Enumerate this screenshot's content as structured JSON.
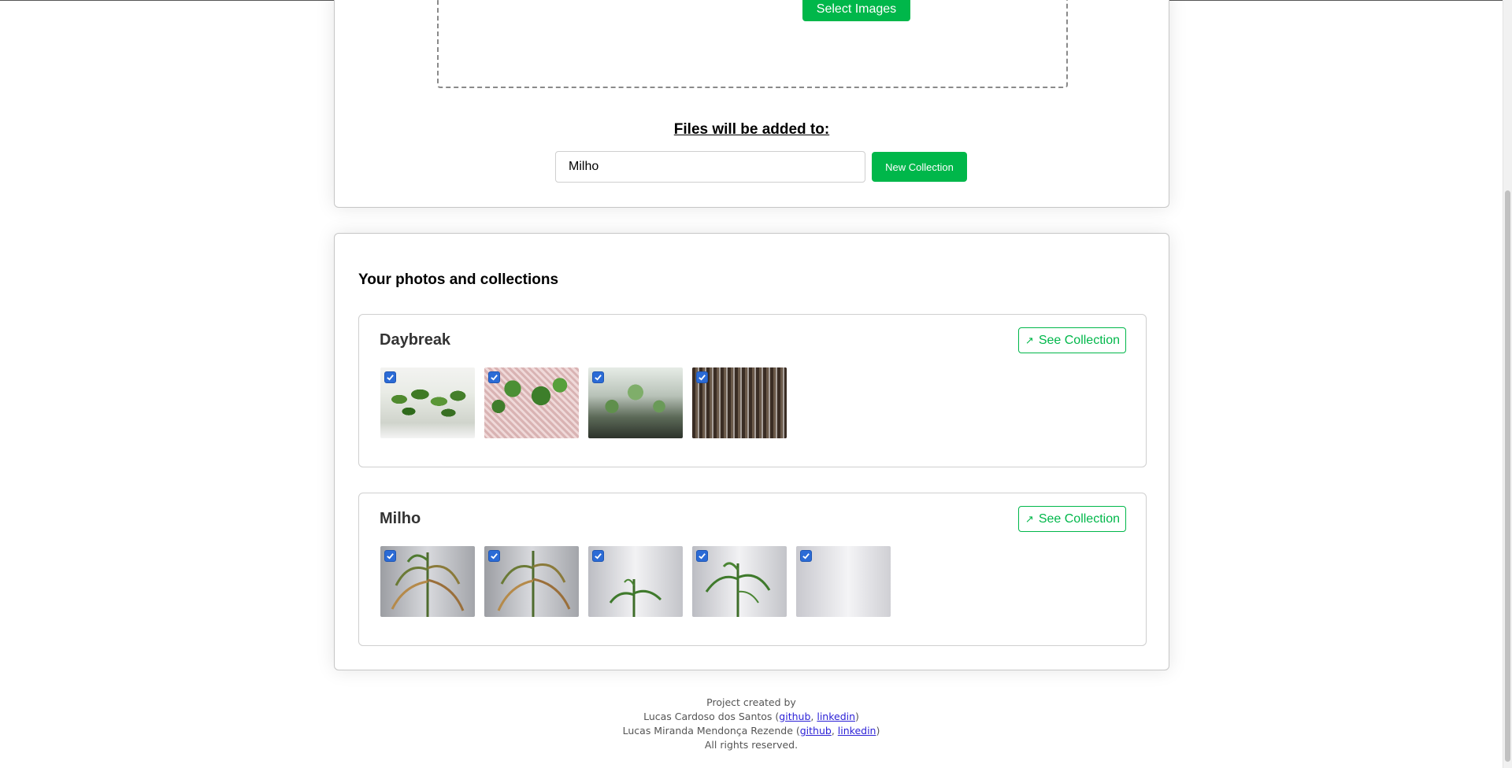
{
  "upload": {
    "select_images_label": "Select Images",
    "files_added_to_label": "Files will be added to:",
    "selected_collection": "Milho",
    "new_collection_label": "New Collection"
  },
  "photos": {
    "title": "Your photos and collections",
    "see_collection_label": "See Collection",
    "collections": [
      {
        "name": "Daybreak",
        "photo_count": 4,
        "all_checked": true
      },
      {
        "name": "Milho",
        "photo_count": 5,
        "all_checked": true
      }
    ]
  },
  "footer": {
    "line1": "Project created by",
    "author1": "Lucas Cardoso dos Santos",
    "author2": "Lucas Miranda Mendonça Rezende",
    "github_label": "github",
    "linkedin_label": "linkedin",
    "rights": "All rights reserved."
  },
  "colors": {
    "accent": "#00b74a",
    "checkbox": "#2b6bd6",
    "link": "#2a1fd6"
  },
  "icons": {
    "see_collection": "external-arrow-icon",
    "checkbox": "check-icon"
  }
}
